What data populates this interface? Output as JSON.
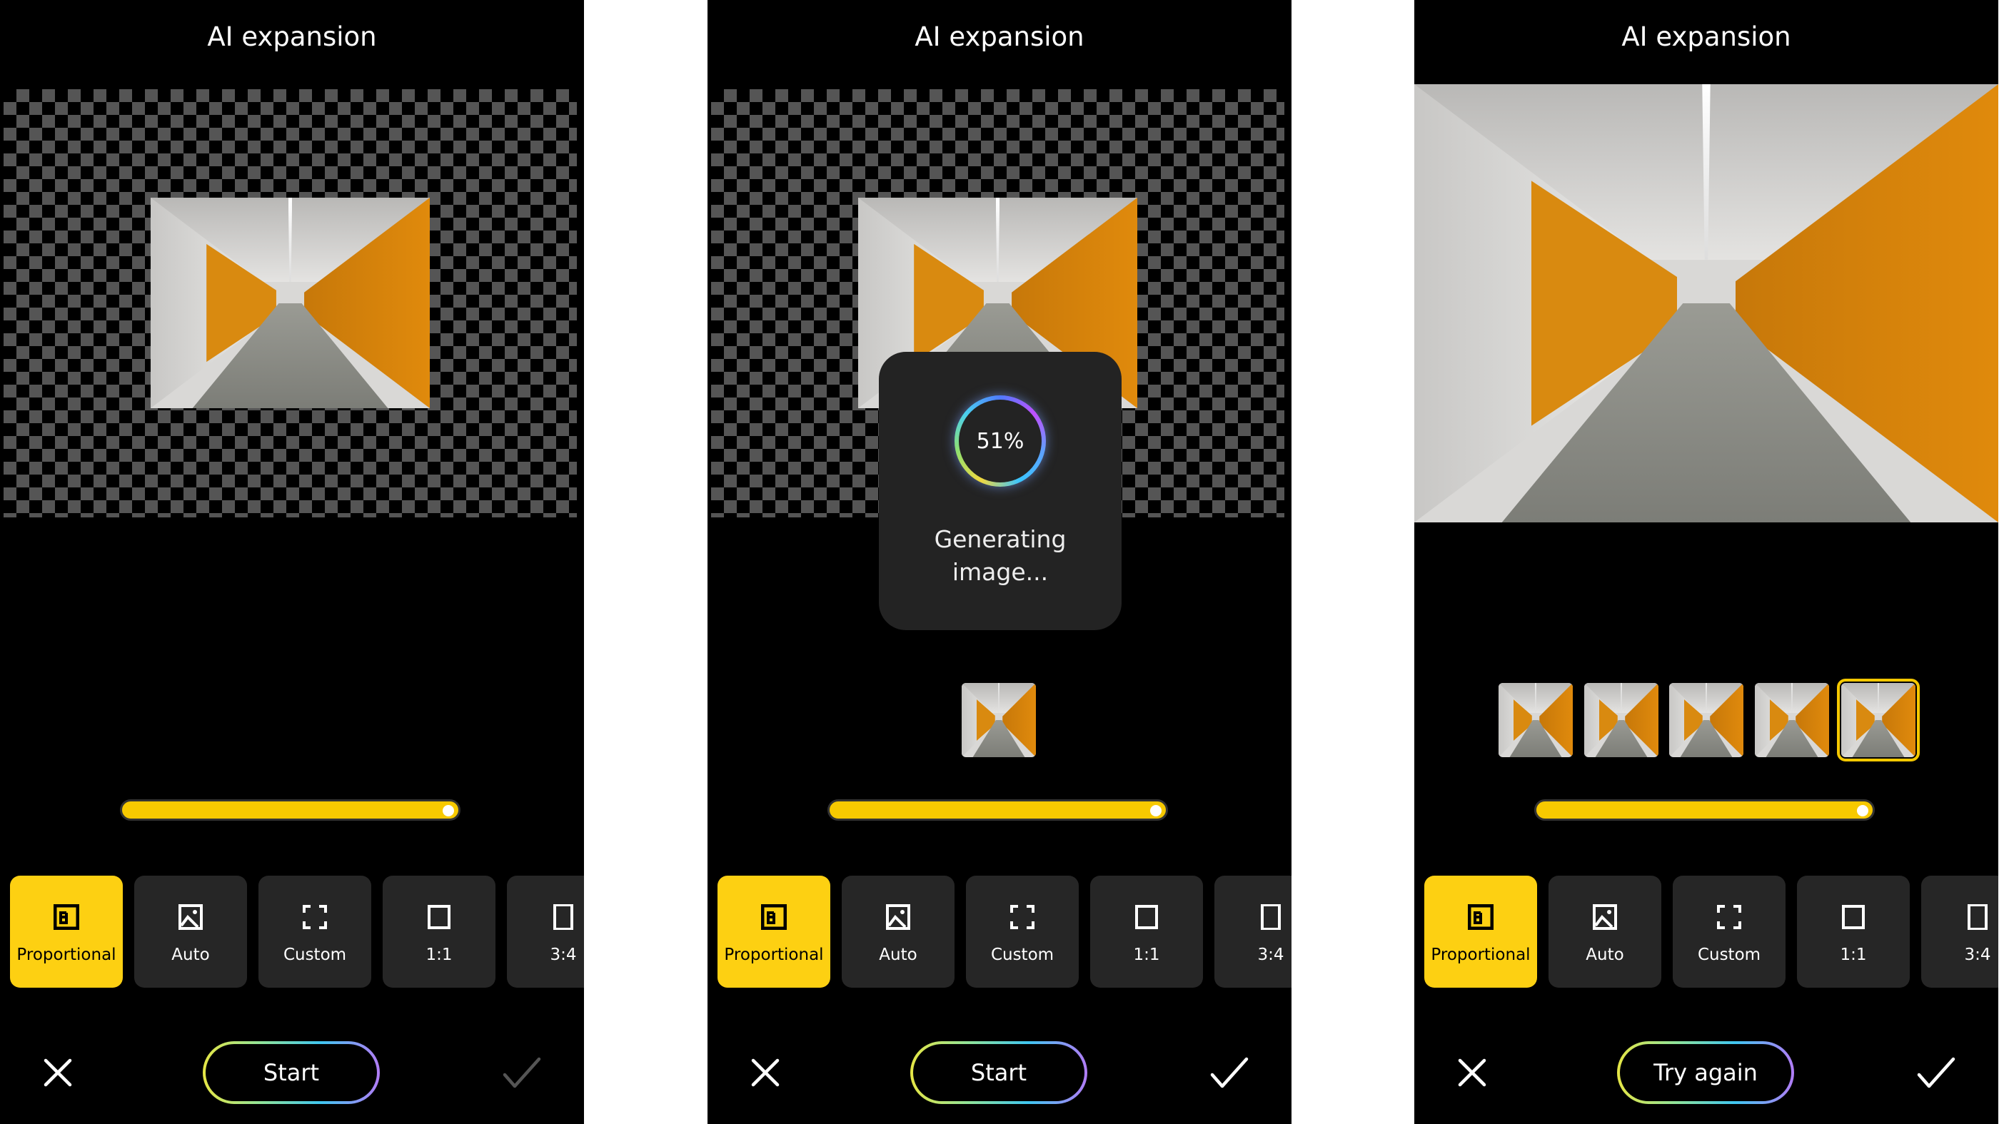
{
  "panels": [
    {
      "title": "AI expansion",
      "state": "initial",
      "progress_text": null,
      "status_text": null,
      "thumbnails": 0,
      "selected_thumbnail": null,
      "primary_button": "Start",
      "confirm_enabled": false,
      "slider_value": 1.0,
      "full_image": false
    },
    {
      "title": "AI expansion",
      "state": "generating",
      "progress_text": "51%",
      "progress_value": 51,
      "status_text": "Generating image...",
      "thumbnails": 1,
      "selected_thumbnail": null,
      "primary_button": "Start",
      "confirm_enabled": true,
      "slider_value": 1.0,
      "full_image": false
    },
    {
      "title": "AI expansion",
      "state": "done",
      "progress_text": null,
      "status_text": null,
      "thumbnails": 5,
      "selected_thumbnail": 4,
      "primary_button": "Try again",
      "confirm_enabled": true,
      "slider_value": 1.0,
      "full_image": true
    }
  ],
  "options": [
    {
      "label": "Proportional",
      "icon": "proportional-icon",
      "active": true
    },
    {
      "label": "Auto",
      "icon": "image-icon",
      "active": false
    },
    {
      "label": "Custom",
      "icon": "custom-frame-icon",
      "active": false
    },
    {
      "label": "1:1",
      "icon": "square-icon",
      "active": false
    },
    {
      "label": "3:4",
      "icon": "portrait-rect-icon",
      "active": false
    }
  ],
  "colors": {
    "accent": "#fdd012",
    "option_bg": "#262626",
    "dialog_bg": "#232323"
  }
}
